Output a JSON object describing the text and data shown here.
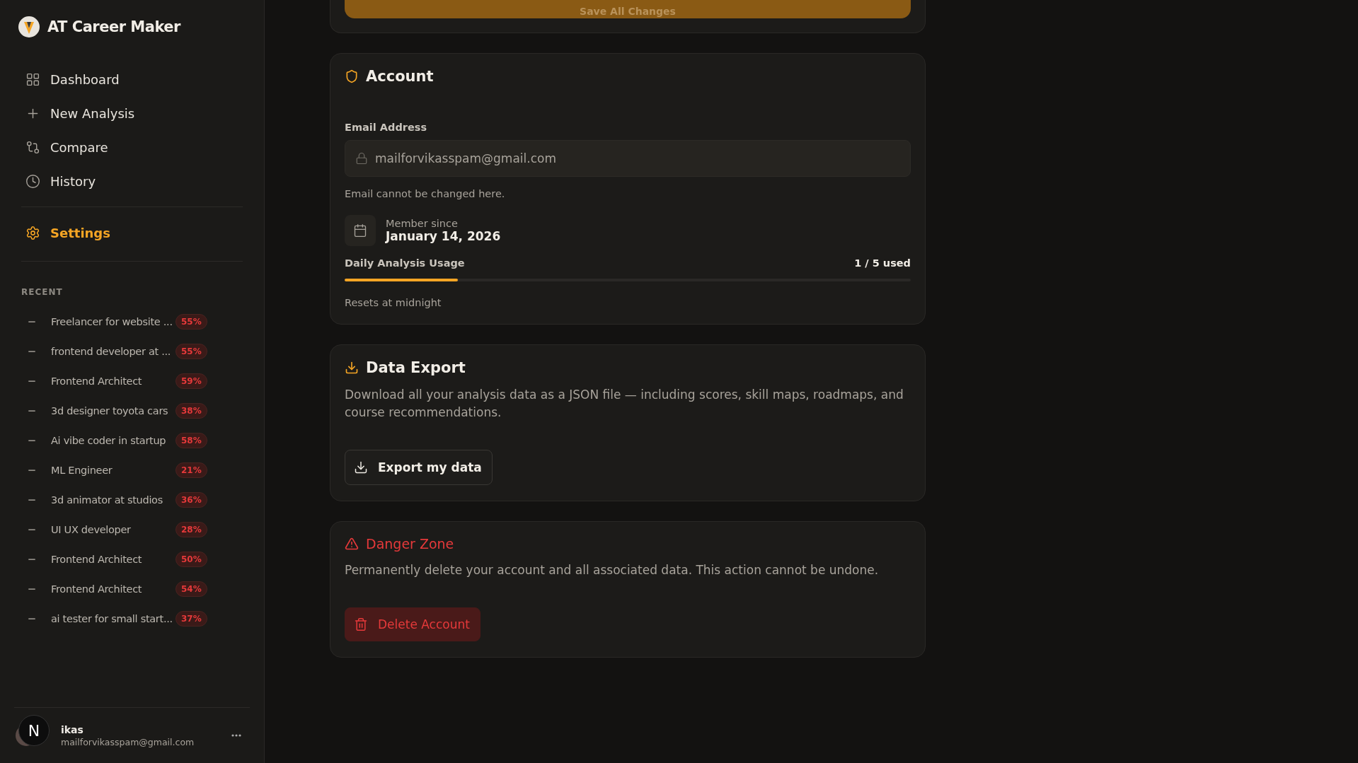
{
  "brand": {
    "name": "AT Career Maker"
  },
  "nav": [
    {
      "label": "Dashboard",
      "selected": false
    },
    {
      "label": "New Analysis",
      "selected": false
    },
    {
      "label": "Compare",
      "selected": false
    },
    {
      "label": "History",
      "selected": false
    }
  ],
  "settings_nav": {
    "label": "Settings",
    "selected": true
  },
  "recent": {
    "title": "RECENT",
    "items": [
      {
        "title": "Freelancer for website ...",
        "score": "55%"
      },
      {
        "title": "frontend developer at ...",
        "score": "55%"
      },
      {
        "title": "Frontend Architect",
        "score": "59%"
      },
      {
        "title": "3d designer toyota cars",
        "score": "38%"
      },
      {
        "title": "Ai vibe coder in startup",
        "score": "58%"
      },
      {
        "title": "ML Engineer",
        "score": "21%"
      },
      {
        "title": "3d animator at studios",
        "score": "36%"
      },
      {
        "title": "UI UX developer",
        "score": "28%"
      },
      {
        "title": "Frontend Architect",
        "score": "50%"
      },
      {
        "title": "Frontend Architect",
        "score": "54%"
      },
      {
        "title": "ai tester for small start...",
        "score": "37%"
      }
    ]
  },
  "user": {
    "badge": "N",
    "name": "ikas",
    "email": "mailforvikasspam@gmail.com"
  },
  "save_button": "Save All Changes",
  "account": {
    "title": "Account",
    "email_label": "Email Address",
    "email_value": "mailforvikasspam@gmail.com",
    "email_hint": "Email cannot be changed here.",
    "member_label": "Member since",
    "member_date": "January 14, 2026",
    "usage_label": "Daily Analysis Usage",
    "usage_reading": "1 / 5 used",
    "level": 0.2,
    "usage_note": "Resets at midnight"
  },
  "data_export": {
    "title": "Data Export",
    "description": "Download all your analysis data as a JSON file — including scores, skill maps, roadmaps, and course recommendations.",
    "button": "Export my data"
  },
  "danger_zone": {
    "title": "Danger Zone",
    "description": "Permanently delete your account and all associated data. This action cannot be undone.",
    "button": "Delete Account"
  }
}
